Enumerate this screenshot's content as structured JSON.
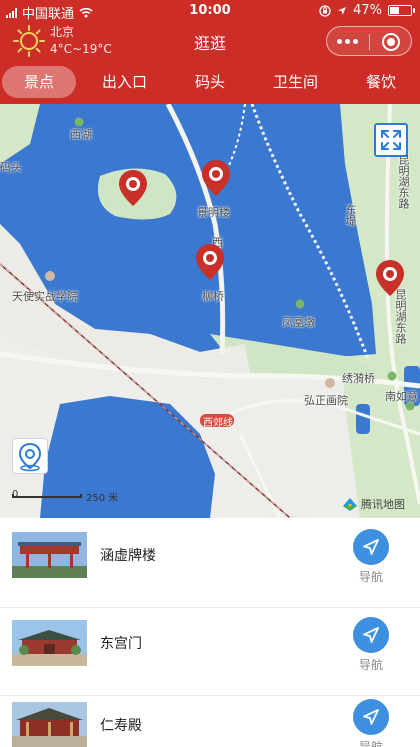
{
  "status_bar": {
    "carrier": "中国联通",
    "time": "10:00",
    "battery_percent_text": "47%",
    "battery_level": 0.47
  },
  "weather": {
    "city": "北京",
    "temperature": "4°C~19°C",
    "icon": "sun-icon"
  },
  "nav": {
    "title": "逛逛",
    "more_icon": "more-dots-icon",
    "close_icon": "close-ring-icon"
  },
  "tabs": [
    {
      "label": "景点",
      "active": true
    },
    {
      "label": "出入口",
      "active": false
    },
    {
      "label": "码头",
      "active": false
    },
    {
      "label": "卫生间",
      "active": false
    },
    {
      "label": "餐饮",
      "active": false
    }
  ],
  "map": {
    "labels": {
      "xihu": "西湖",
      "matou": "码头",
      "jingminglou": "景明楼",
      "xi": "西",
      "liuqiao": "柳桥",
      "tianshi": "天使实战学院",
      "fenghuangdun": "凤凰墩",
      "xiuyiqiao": "绣漪桥",
      "nanruyi": "南如意",
      "hongzheng": "弘正画院",
      "xijiaoxian": "西郊线",
      "kunming_road": "昆明湖东路",
      "kunming_road2": "昆明湖东路",
      "dongdi": "东堤"
    },
    "scale": {
      "unit_value": "250 米",
      "zero": "0"
    },
    "provider": "腾讯地图",
    "fullscreen_icon": "fullscreen-icon",
    "locate_icon": "locate-icon",
    "colors": {
      "water": "#3b78cf",
      "land": "#ededea",
      "green": "#cfe6c4",
      "marker": "#c8302a",
      "accent": "#cc2d26",
      "nav_button": "#3d8fe0"
    }
  },
  "spots": [
    {
      "name": "涵虚牌楼",
      "nav_label": "导航"
    },
    {
      "name": "东宫门",
      "nav_label": "导航"
    },
    {
      "name": "仁寿殿",
      "nav_label": "导航"
    }
  ]
}
